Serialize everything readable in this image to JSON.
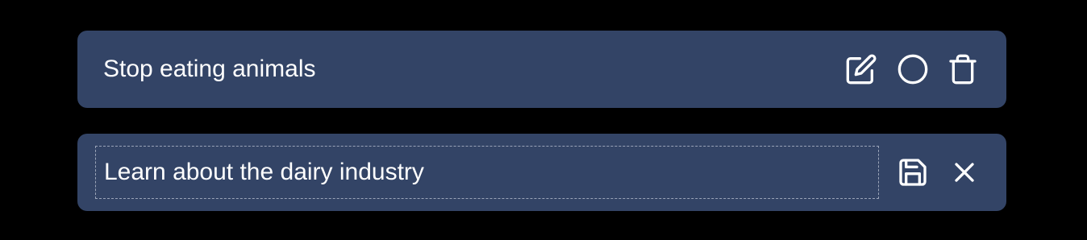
{
  "todos": [
    {
      "text": "Stop eating animals",
      "mode": "view",
      "actions": [
        "edit-icon",
        "circle-icon",
        "trash-icon"
      ]
    },
    {
      "text": "Learn about the dairy industry",
      "mode": "editing",
      "actions": [
        "save-icon",
        "close-icon"
      ]
    }
  ],
  "colors": {
    "background": "#000000",
    "item_background": "#334466",
    "text": "#ffffff",
    "input_border": "#9aa4b8"
  }
}
